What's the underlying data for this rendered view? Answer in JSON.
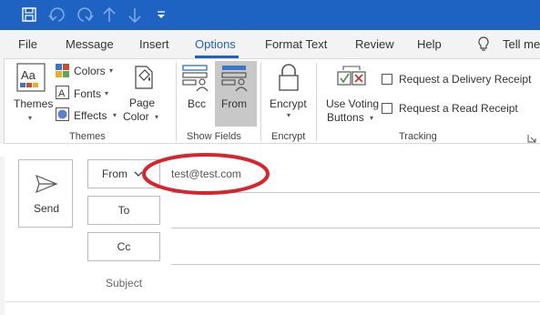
{
  "quick_access": {
    "save_icon": "save-icon",
    "undo_icon": "undo-icon",
    "redo_icon": "redo-icon",
    "up_icon": "arrow-up-icon",
    "down_icon": "arrow-down-icon",
    "customize_icon": "customize-toolbar-icon"
  },
  "tabs": [
    "File",
    "Message",
    "Insert",
    "Options",
    "Format Text",
    "Review",
    "Help"
  ],
  "active_tab": "Options",
  "tell_me": "Tell me",
  "ribbon": {
    "themes_group": {
      "themes_label": "Themes",
      "colors_label": "Colors",
      "fonts_label": "Fonts",
      "effects_label": "Effects",
      "page_color_line1": "Page",
      "page_color_line2": "Color",
      "group_label": "Themes"
    },
    "show_fields_group": {
      "bcc_label": "Bcc",
      "from_label": "From",
      "group_label": "Show Fields"
    },
    "encrypt_group": {
      "encrypt_label": "Encrypt",
      "group_label": "Encrypt"
    },
    "tracking_group": {
      "voting_line1": "Use Voting",
      "voting_line2": "Buttons",
      "delivery_receipt": "Request a Delivery Receipt",
      "read_receipt": "Request a Read Receipt",
      "group_label": "Tracking"
    }
  },
  "compose": {
    "send_label": "Send",
    "from_button": "From",
    "from_value": "test@test.com",
    "to_button": "To",
    "cc_button": "Cc",
    "subject_label": "Subject"
  },
  "colors": {
    "accent": "#1f63c2",
    "annotation": "#d9232d"
  }
}
